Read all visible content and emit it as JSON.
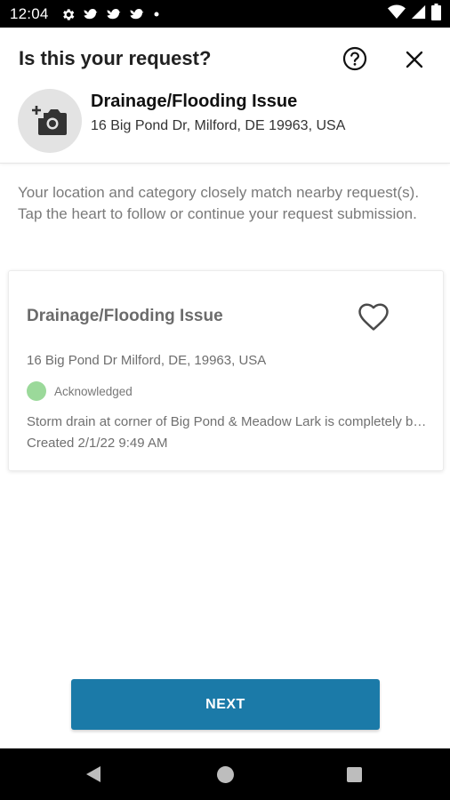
{
  "status_bar": {
    "time": "12:04",
    "left_icons": [
      "settings-icon",
      "bird-icon",
      "bird-icon",
      "bird-icon",
      "dot-icon"
    ],
    "right_icons": [
      "wifi-icon",
      "signal-icon",
      "battery-icon"
    ]
  },
  "header": {
    "title": "Is this your request?",
    "help_icon": "help-circle-icon",
    "close_icon": "close-icon",
    "photo_icon": "add-photo-icon",
    "category": "Drainage/Flooding Issue",
    "address": "16 Big Pond Dr, Milford, DE 19963, USA"
  },
  "info_text": "Your location and category closely match nearby request(s). Tap the heart to follow or continue your request submission.",
  "matches": [
    {
      "title": "Drainage/Flooding Issue",
      "address": "16 Big Pond Dr Milford, DE, 19963, USA",
      "status": "Acknowledged",
      "status_color": "#9bd99a",
      "description": "Storm drain at corner of Big Pond & Meadow Lark is completely blocked",
      "created": "Created 2/1/22 9:49 AM"
    }
  ],
  "next_button": "NEXT",
  "colors": {
    "primary": "#1b7aa8",
    "status_bar": "#000000"
  }
}
